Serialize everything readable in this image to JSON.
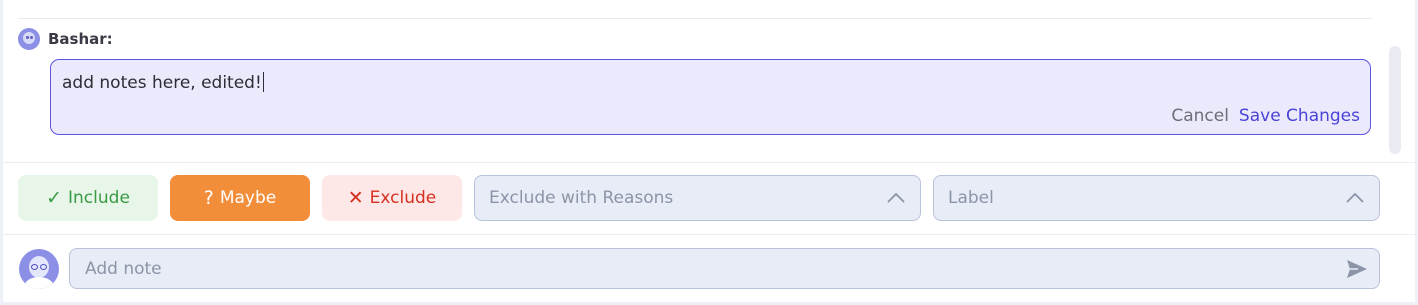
{
  "note": {
    "author": "Bashar:",
    "edit_text": "add notes here, edited!",
    "cancel_label": "Cancel",
    "save_label": "Save Changes"
  },
  "actions": {
    "include_label": "Include",
    "include_icon": "check-icon",
    "maybe_label": "Maybe",
    "maybe_icon": "question-icon",
    "exclude_label": "Exclude",
    "exclude_icon": "x-icon",
    "reasons_placeholder": "Exclude with Reasons",
    "label_placeholder": "Label"
  },
  "composer": {
    "placeholder": "Add note",
    "send_icon": "send-icon"
  },
  "colors": {
    "accent": "#4a43d8",
    "include_bg": "#e8f6ea",
    "include_text": "#3a9a43",
    "maybe_bg": "#f28d3a",
    "exclude_bg": "#fde7e7",
    "exclude_text": "#d6301f",
    "edit_bg": "#ebeafc",
    "avatar": "#8b8fe6"
  }
}
